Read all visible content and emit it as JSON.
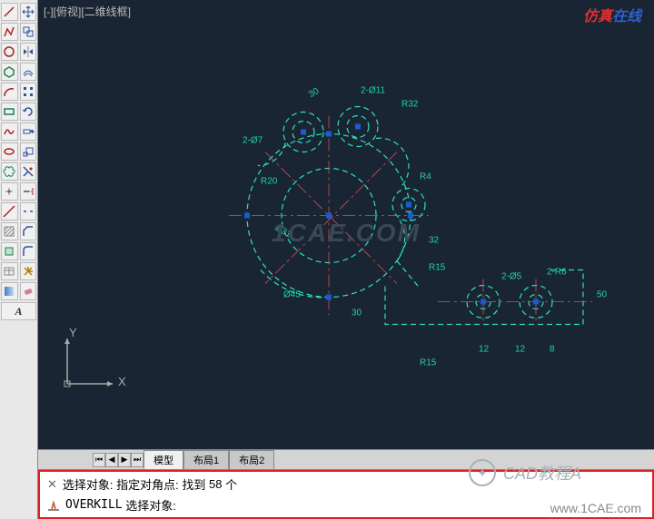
{
  "view_label": "[-][俯视][二维线框]",
  "ucs": {
    "x": "X",
    "y": "Y"
  },
  "tabs": {
    "active": "模型",
    "items": [
      "模型",
      "布局1",
      "布局2"
    ]
  },
  "command": {
    "line1_prefix": "选择对象: 指定对角点: 找到",
    "line1_count": "58",
    "line1_suffix": "个",
    "line2_cmd": "OVERKILL",
    "line2_rest": "选择对象:"
  },
  "watermark": {
    "center": "1CAE.COM",
    "top_right_a": "仿真",
    "top_right_b": "在线",
    "bottom_right": "www.1CAE.com",
    "wechat": "CAD教程A"
  },
  "dimensions": {
    "d1": "30",
    "d2": "2-Ø11",
    "d3": "R32",
    "d4": "2-Ø7",
    "d5": "R20",
    "d6": "R4",
    "d7": "Ø31",
    "d8": "32",
    "d9": "Ø45",
    "d10": "R15",
    "d11": "30",
    "d12": "2-Ø5",
    "d13": "2-R6",
    "d14": "50",
    "d15": "R15",
    "d16": "12",
    "d17": "12",
    "d18": "8"
  }
}
